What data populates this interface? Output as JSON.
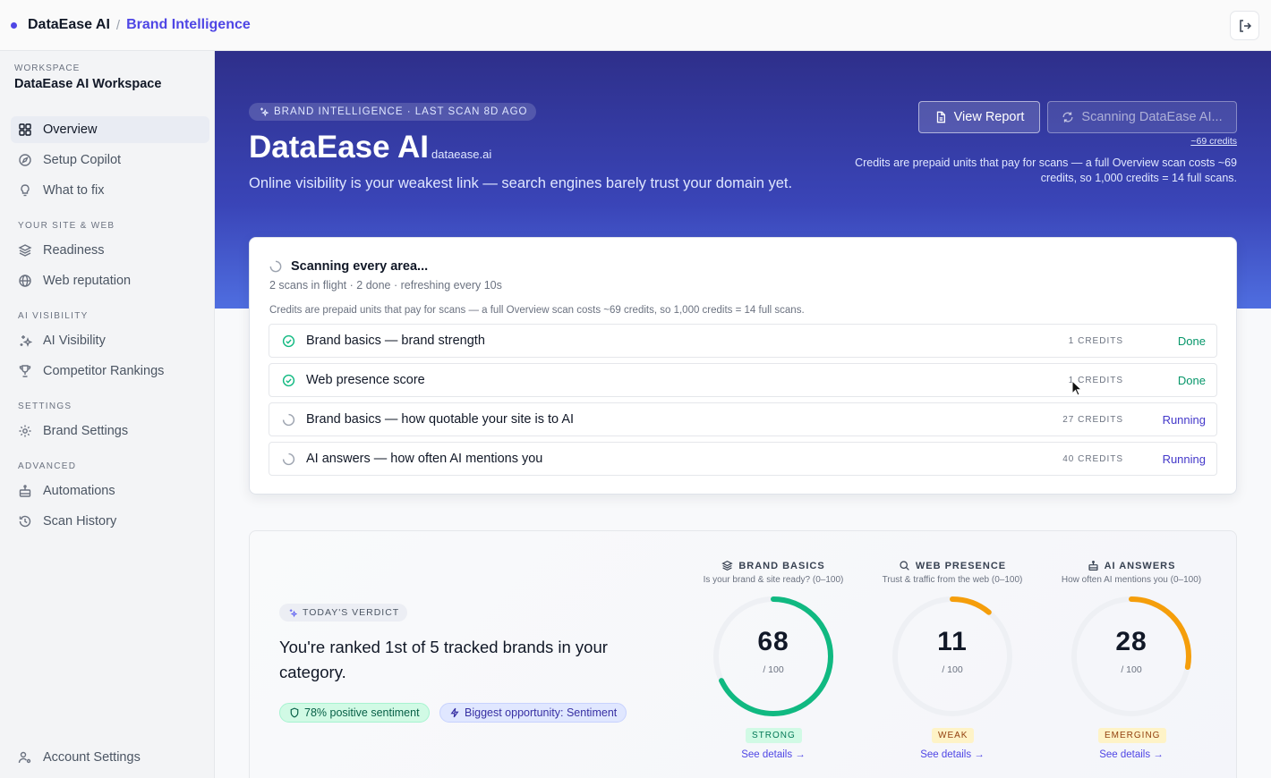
{
  "topbar": {
    "app": "DataEase AI",
    "separator": "/",
    "crumb": "Brand Intelligence"
  },
  "sidebar": {
    "workspace_label": "WORKSPACE",
    "workspace_name": "DataEase AI Workspace",
    "items": [
      {
        "label": "Overview",
        "icon": "grid-icon",
        "active": true
      },
      {
        "label": "Setup Copilot",
        "icon": "compass-icon"
      },
      {
        "label": "What to fix",
        "icon": "lightbulb-icon"
      }
    ],
    "groups": [
      {
        "label": "YOUR SITE & WEB",
        "items": [
          {
            "label": "Readiness",
            "icon": "layers-icon"
          },
          {
            "label": "Web reputation",
            "icon": "globe-icon"
          }
        ]
      },
      {
        "label": "AI VISIBILITY",
        "items": [
          {
            "label": "AI Visibility",
            "icon": "sparkles-icon"
          },
          {
            "label": "Competitor Rankings",
            "icon": "trophy-icon"
          }
        ]
      },
      {
        "label": "SETTINGS",
        "items": [
          {
            "label": "Brand Settings",
            "icon": "gear-icon"
          }
        ]
      },
      {
        "label": "ADVANCED",
        "items": [
          {
            "label": "Automations",
            "icon": "robot-icon"
          },
          {
            "label": "Scan History",
            "icon": "history-icon"
          }
        ]
      }
    ],
    "footer": {
      "label": "Account Settings",
      "icon": "user-settings-icon"
    }
  },
  "hero": {
    "badge": "BRAND INTELLIGENCE · LAST SCAN 8D AGO",
    "title": "DataEase AI",
    "domain": "dataease.ai",
    "subtitle": "Online visibility is your weakest link — search engines barely trust your domain yet.",
    "view_report": "View Report",
    "scanning_button": "Scanning DataEase AI...",
    "credits_link": "~69 credits",
    "credits_note": "Credits are prepaid units that pay for scans — a full Overview scan costs ~69 credits, so 1,000 credits = 14 full scans."
  },
  "scan": {
    "title": "Scanning every area...",
    "meta": "2 scans in flight · 2 done · refreshing every 10s",
    "note": "Credits are prepaid units that pay for scans — a full Overview scan costs ~69 credits, so 1,000 credits = 14 full scans.",
    "rows": [
      {
        "label": "Brand basics — brand strength",
        "credits": "1 CREDITS",
        "status": "Done"
      },
      {
        "label": "Web presence score",
        "credits": "1 CREDITS",
        "status": "Done"
      },
      {
        "label": "Brand basics — how quotable your site is to AI",
        "credits": "27 CREDITS",
        "status": "Running"
      },
      {
        "label": "AI answers — how often AI mentions you",
        "credits": "40 CREDITS",
        "status": "Running"
      }
    ]
  },
  "verdict": {
    "badge": "TODAY'S VERDICT",
    "headline": "You're ranked 1st of 5 tracked brands in your category.",
    "sentiment_pill": "78% positive sentiment",
    "opportunity_pill": "Biggest opportunity: Sentiment",
    "metrics": [
      {
        "title": "BRAND BASICS",
        "icon": "layers-icon",
        "subtitle": "Is your brand & site ready? (0–100)",
        "value": "68",
        "score": 68,
        "denominator": "/ 100",
        "band": "STRONG",
        "color": "#10b981",
        "link": "See details"
      },
      {
        "title": "WEB PRESENCE",
        "icon": "search-icon",
        "subtitle": "Trust & traffic from the web (0–100)",
        "value": "11",
        "score": 11,
        "denominator": "/ 100",
        "band": "WEAK",
        "color": "#f59e0b",
        "link": "See details"
      },
      {
        "title": "AI ANSWERS",
        "icon": "robot-icon",
        "subtitle": "How often AI mentions you (0–100)",
        "value": "28",
        "score": 28,
        "denominator": "/ 100",
        "band": "EMERGING",
        "color": "#f59e0b",
        "link": "See details"
      }
    ]
  }
}
